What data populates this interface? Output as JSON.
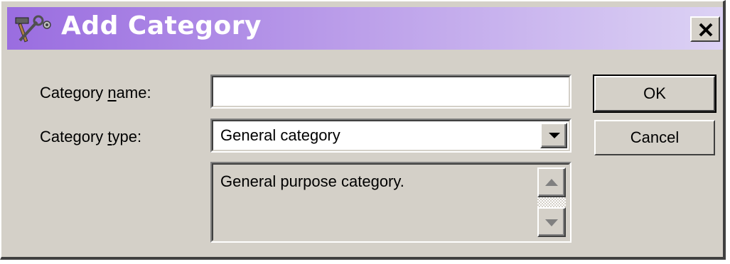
{
  "window": {
    "title": "Add Category",
    "icon": "tools-icon",
    "close_icon": "close-icon"
  },
  "form": {
    "name_label_prefix": "Category ",
    "name_label_access": "n",
    "name_label_suffix": "ame:",
    "name_value": "",
    "type_label_prefix": "Category ",
    "type_label_access": "t",
    "type_label_suffix": "ype:",
    "type_selected": "General category",
    "description": "General purpose category."
  },
  "buttons": {
    "ok": "OK",
    "cancel": "Cancel"
  },
  "colors": {
    "title_gradient_start": "#9a6de0",
    "title_gradient_end": "#dcd2f4",
    "face": "#d4d0c8"
  }
}
